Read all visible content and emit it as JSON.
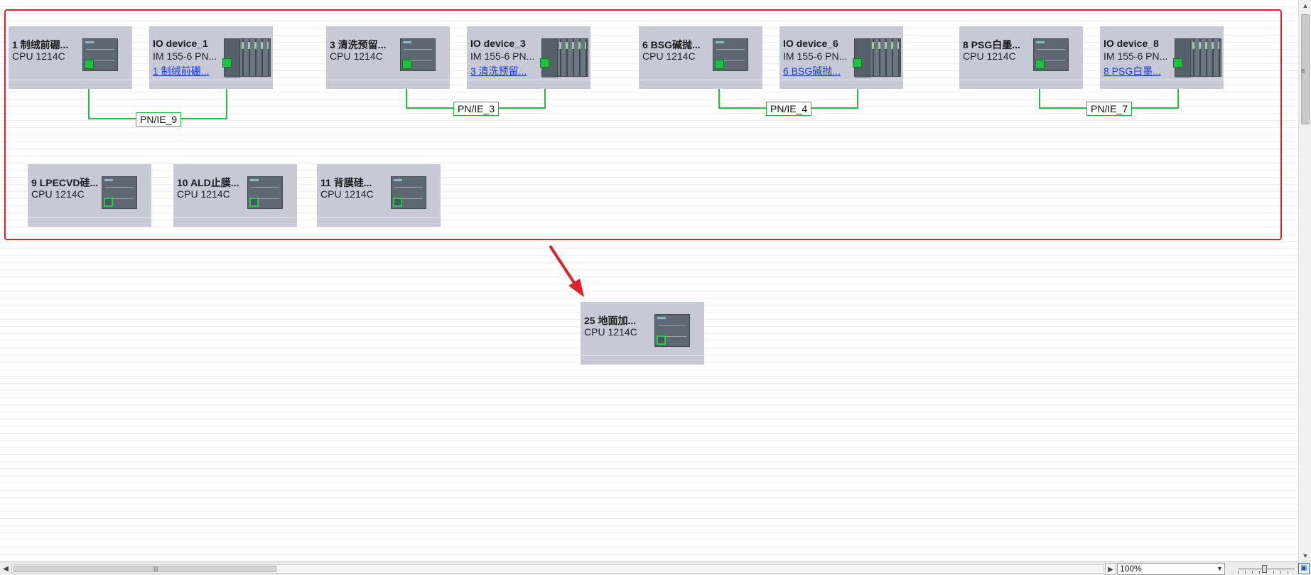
{
  "devices": [
    {
      "id": "d1",
      "name": "1 制绒前硼...",
      "type": "CPU 1214C"
    },
    {
      "id": "d2",
      "name": "IO device_1",
      "type": "IM 155-6 PN...",
      "link": "1 制绒前硼..."
    },
    {
      "id": "d3",
      "name": "3 清洗预留...",
      "type": "CPU 1214C"
    },
    {
      "id": "d4",
      "name": "IO device_3",
      "type": "IM 155-6 PN...",
      "link": "3 清洗预留..."
    },
    {
      "id": "d5",
      "name": "6 BSG碱抛...",
      "type": "CPU 1214C"
    },
    {
      "id": "d6",
      "name": "IO device_6",
      "type": "IM 155-6 PN...",
      "link": "6 BSG碱抛..."
    },
    {
      "id": "d7",
      "name": "8 PSG白墨...",
      "type": "CPU 1214C"
    },
    {
      "id": "d8",
      "name": "IO device_8",
      "type": "IM 155-6 PN...",
      "link": "8 PSG白墨..."
    },
    {
      "id": "d9",
      "name": "9 LPECVD硅...",
      "type": "CPU 1214C"
    },
    {
      "id": "d10",
      "name": "10 ALD止膜...",
      "type": "CPU 1214C"
    },
    {
      "id": "d11",
      "name": "11 背膜硅...",
      "type": "CPU 1214C"
    },
    {
      "id": "d12",
      "name": "25 地面加...",
      "type": "CPU 1214C"
    }
  ],
  "networks": [
    {
      "id": "n1",
      "label": "PN/IE_9"
    },
    {
      "id": "n2",
      "label": "PN/IE_3"
    },
    {
      "id": "n3",
      "label": "PN/IE_4"
    },
    {
      "id": "n4",
      "label": "PN/IE_7"
    }
  ],
  "statusbar": {
    "zoom": "100%"
  },
  "colors": {
    "highlight": "#e0202a",
    "network_wire": "#22c03c",
    "device_bg": "#c8c9d6",
    "link_text": "#1a3bd6"
  }
}
